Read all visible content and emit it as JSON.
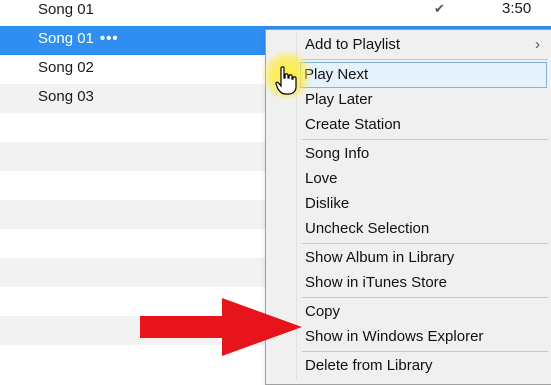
{
  "tracks": [
    {
      "title": "Song 01",
      "check": "✔",
      "duration": "3:50"
    },
    {
      "title": "Song 01",
      "dots": "•••",
      "selected": true
    },
    {
      "title": "Song 02"
    },
    {
      "title": "Song 03"
    }
  ],
  "context_menu": {
    "items": [
      {
        "label": "Add to Playlist",
        "submenu_arrow": "›"
      },
      {
        "label": "Play Next",
        "highlighted": true
      },
      {
        "label": "Play Later"
      },
      {
        "label": "Create Station"
      },
      {
        "label": "Song Info"
      },
      {
        "label": "Love"
      },
      {
        "label": "Dislike"
      },
      {
        "label": "Uncheck Selection"
      },
      {
        "label": "Show Album in Library"
      },
      {
        "label": "Show in iTunes Store"
      },
      {
        "label": "Copy"
      },
      {
        "label": "Show in Windows Explorer"
      },
      {
        "label": "Delete from Library"
      }
    ]
  },
  "colors": {
    "selection": "#2e8ff0",
    "menu_highlight": "#e5f1fb",
    "annotation_arrow": "#e8141b",
    "cursor_glow": "#fff028"
  },
  "icons": {
    "cursor": "hand-pointer-icon",
    "annotation": "red-arrow-icon",
    "check": "checkmark-icon"
  }
}
